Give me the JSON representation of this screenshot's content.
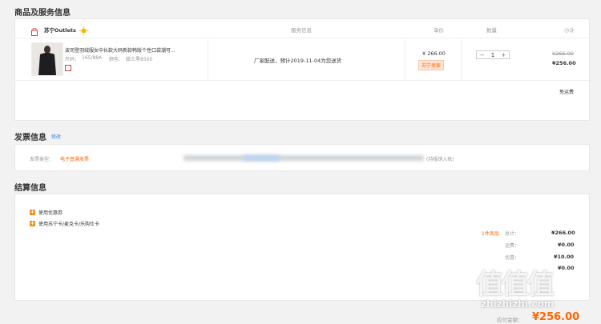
{
  "sections": {
    "goods_title": "商品及服务信息",
    "invoice_title": "发票信息",
    "invoice_edit": "修改",
    "settlement_title": "结算信息"
  },
  "table": {
    "store_name": "苏宁Outlets",
    "col_service": "服务信息",
    "col_price": "单价",
    "col_qty": "数量",
    "col_subtotal": "小计"
  },
  "item": {
    "title": "波司登羽绒服女中长款大码新款韩版个性口袋潮可...",
    "size_label": "尺码：",
    "size": "165/88A",
    "color_label": "颜色：",
    "color": "碳士黑8500",
    "service": "厂家配送，预计2019-11-04为您送货",
    "price": "¥ 266.00",
    "price_tag": "苏宁卖家",
    "qty_minus": "−",
    "qty": "1",
    "qty_plus": "+",
    "subtotal_original": "¥266.00",
    "subtotal": "¥256.00",
    "shipping": "免运费"
  },
  "invoice": {
    "type_label": "发票类型：",
    "type_value": "电子普通发票",
    "note_tail": "(持报销入账)"
  },
  "settlement": {
    "coupon_label": "使用优惠券",
    "card_label": "使用苏宁卡/麦克卡/乐购仕卡",
    "count_text": "1件商品",
    "total_label": "总计：",
    "total_value": "¥266.00",
    "shipping_label": "运费：",
    "shipping_value": "¥0.00",
    "discount_label": "优惠：",
    "discount_value": "¥10.00",
    "other_value": "¥0.00",
    "pay_label": "应付金额：",
    "pay_value": "¥256.00"
  },
  "watermark": {
    "top": "值值值",
    "bottom": "zhizhizhi.com"
  },
  "colors": {
    "accent": "#ff6600",
    "link": "#3a86d8",
    "tag_bg": "#fde4d4"
  }
}
